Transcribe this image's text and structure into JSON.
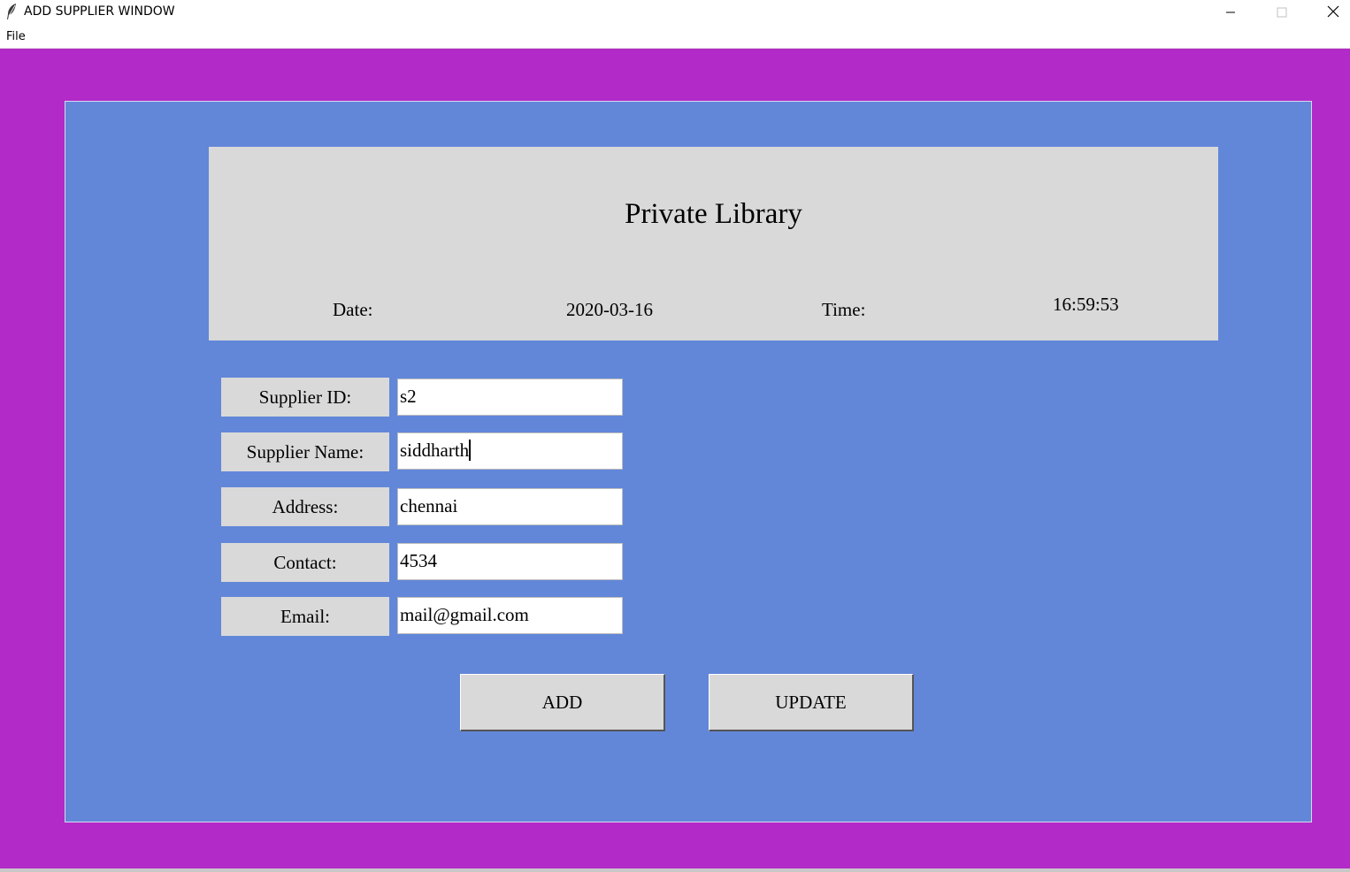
{
  "window": {
    "title": "ADD SUPPLIER WINDOW",
    "app_icon": "feather-icon",
    "controls": [
      "minimize-icon",
      "maximize-icon",
      "close-icon"
    ]
  },
  "menu": {
    "file": "File"
  },
  "colors": {
    "outer_background": "#b22ac7",
    "inner_background": "#6287d9",
    "panel_background": "#d9d9d9"
  },
  "header": {
    "title": "Private Library",
    "date_label": "Date:",
    "date_value": "2020-03-16",
    "time_label": "Time:",
    "time_value": "16:59:53"
  },
  "form": {
    "supplier_id": {
      "label": "Supplier ID:",
      "value": "s2"
    },
    "supplier_name": {
      "label": "Supplier Name:",
      "value": "siddharth"
    },
    "address": {
      "label": "Address:",
      "value": "chennai"
    },
    "contact": {
      "label": "Contact:",
      "value": "4534"
    },
    "email": {
      "label": "Email:",
      "value": "mail@gmail.com"
    }
  },
  "buttons": {
    "add": "ADD",
    "update": "UPDATE"
  }
}
